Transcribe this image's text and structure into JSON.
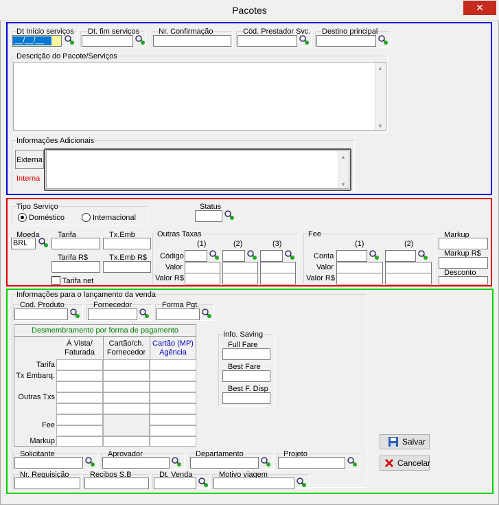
{
  "window": {
    "title": "Pacotes",
    "close_glyph": "✕"
  },
  "top": {
    "dt_inicio_label": "Dt Início serviços",
    "dt_inicio_value": "__/__/__",
    "dt_fim_label": "Dt. fim serviços",
    "nr_confirmacao_label": "Nr. Confirmação",
    "cod_prestador_label": "Cód. Prestador Svc.",
    "destino_label": "Destino principal",
    "descricao_label": "Descrição do Pacote/Serviços",
    "info_adicionais_label": "Informações Adicionais",
    "tab_externa": "Externa",
    "tab_interna": "Interna"
  },
  "tipo": {
    "tipo_servico_label": "Tipo Serviço",
    "domestico": "Doméstico",
    "internacional": "Internacional",
    "status_label": "Status",
    "moeda_label": "Moeda",
    "moeda_value": "BRL",
    "tarifa_label": "Tarifa",
    "txemb_label": "Tx.Emb",
    "tarifa_rs_label": "Tarifa R$",
    "txemb_rs_label": "Tx.Emb R$",
    "tarifa_net_label": "Tarifa net",
    "outras_taxas_label": "Outras Taxas",
    "col1": "(1)",
    "col2": "(2)",
    "col3": "(3)",
    "codigo_label": "Código",
    "valor_label": "Valor",
    "valor_rs_label": "Valor R$",
    "fee_label": "Fee",
    "conta_label": "Conta",
    "markup_label": "Markup",
    "markup_rs_label": "Markup R$",
    "desconto_label": "Desconto"
  },
  "venda": {
    "section_label": "Informações para o lançamento da venda",
    "cod_produto_label": "Cod. Produto",
    "fornecedor_label": "Fornecedor",
    "forma_pgt_label": "Forma Pgt.",
    "desmembramento_label": "Desmembramento por forma de pagamento",
    "col_avista": "À Vista/\nFaturada",
    "col_cartao": "Cartão/ch.\nFornecedor",
    "col_cartao_mp": "Cartão (MP)\nAgência",
    "row_tarifa": "Tarifa",
    "row_tx": "Tx Embarq.",
    "row_outras": "Outras Txs",
    "row_fee": "Fee",
    "row_markup": "Markup",
    "info_saving_label": "Info. Saving",
    "full_fare_label": "Full Fare",
    "best_fare_label": "Best Fare",
    "best_f_disp_label": "Best F. Disp",
    "solicitante_label": "Solicitante",
    "aprovador_label": "Aprovador",
    "departamento_label": "Departamento",
    "projeto_label": "Projeto",
    "nr_requisicao_label": "Nr. Requisição",
    "recibos_label": "Recibos S.B",
    "dt_venda_label": "Dt. Venda",
    "motivo_label": "Motivo viagem"
  },
  "buttons": {
    "salvar": "Salvar",
    "cancelar": "Cancelar"
  },
  "colors": {
    "blue_frame": "#0000e0",
    "red_frame": "#e00000",
    "green_frame": "#00d000",
    "accent": "#0078d7"
  }
}
